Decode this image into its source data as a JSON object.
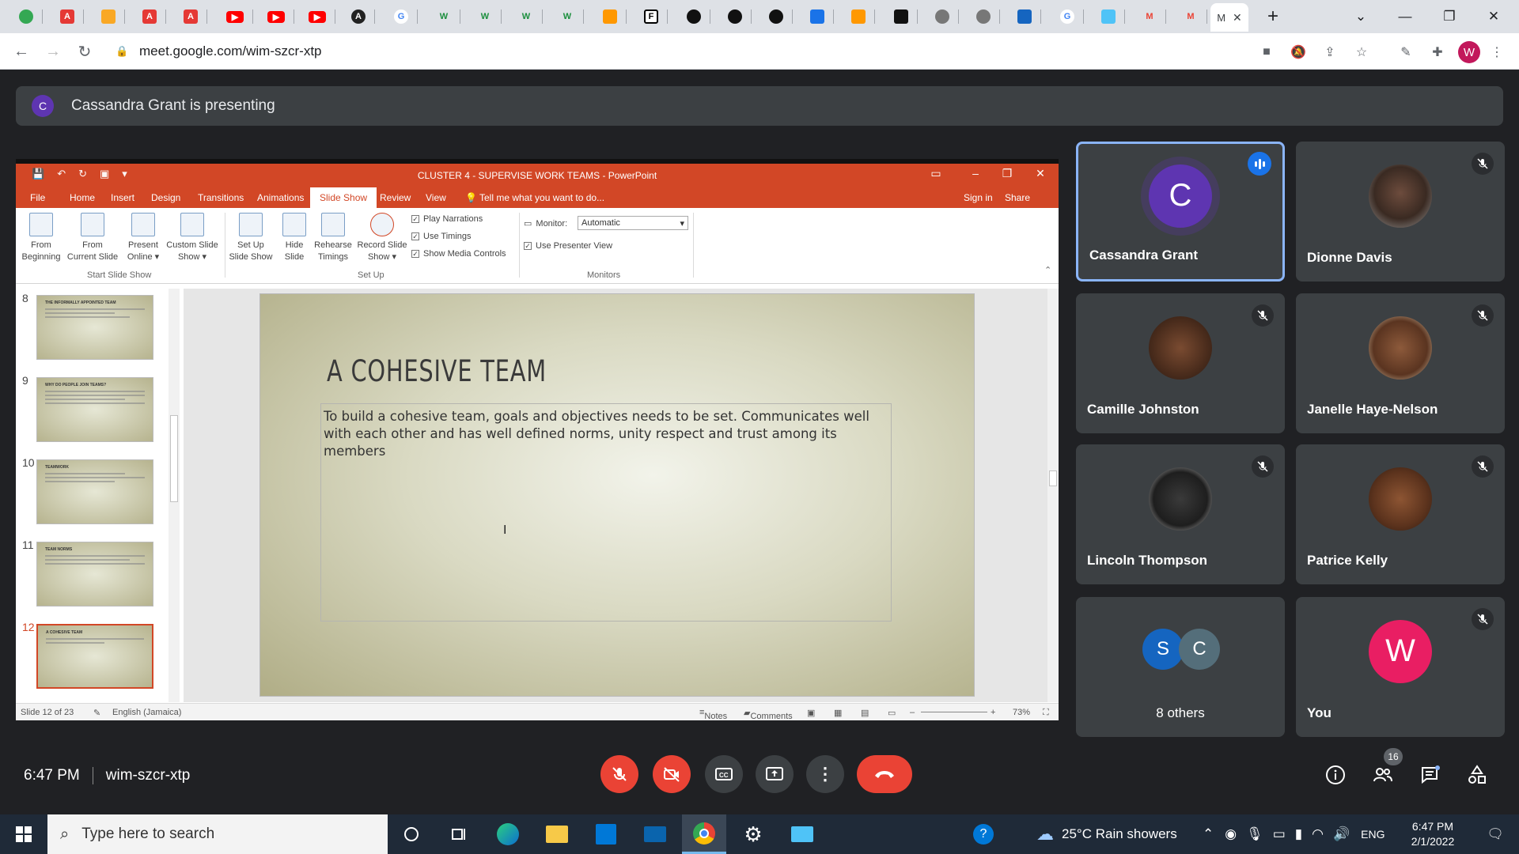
{
  "browser": {
    "active_tab_title": "M",
    "url": "meet.google.com/wim-szcr-xtp",
    "profile_initial": "W"
  },
  "meet": {
    "presenting_banner": "Cassandra Grant is presenting",
    "presenter_initial": "C",
    "time": "6:47 PM",
    "meeting_code": "wim-szcr-xtp",
    "participants_count": "16",
    "tiles": {
      "t1": {
        "name": "Cassandra Grant",
        "initial": "C"
      },
      "t2": {
        "name": "Dionne Davis"
      },
      "t3": {
        "name": "Camille Johnston"
      },
      "t4": {
        "name": "Janelle Haye-Nelson"
      },
      "t5": {
        "name": "Lincoln Thompson"
      },
      "t6": {
        "name": "Patrice Kelly"
      },
      "t7": {
        "name": "8 others",
        "initial_a": "S",
        "initial_b": "C"
      },
      "t8": {
        "name": "You",
        "initial": "W"
      }
    }
  },
  "ppt": {
    "window_title": "CLUSTER 4 - SUPERVISE WORK TEAMS - PowerPoint",
    "menu": {
      "file": "File",
      "home": "Home",
      "insert": "Insert",
      "design": "Design",
      "transitions": "Transitions",
      "animations": "Animations",
      "slideshow": "Slide Show",
      "review": "Review",
      "view": "View",
      "tell": "Tell me what you want to do...",
      "signin": "Sign in",
      "share": "Share"
    },
    "ribbon": {
      "from_beginning": "From\nBeginning",
      "from_current": "From\nCurrent Slide",
      "present_online": "Present\nOnline ▾",
      "custom_slide": "Custom Slide\nShow ▾",
      "setup_show": "Set Up\nSlide Show",
      "hide_slide": "Hide\nSlide",
      "rehearse": "Rehearse\nTimings",
      "record": "Record Slide\nShow ▾",
      "play_narrations": "Play Narrations",
      "use_timings": "Use Timings",
      "show_media": "Show Media Controls",
      "monitor_label": "Monitor:",
      "monitor_value": "Automatic",
      "use_presenter": "Use Presenter View",
      "group_start": "Start Slide Show",
      "group_setup": "Set Up",
      "group_monitors": "Monitors"
    },
    "thumbnails": [
      {
        "num": "8",
        "title": "THE INFORMALLY APPOINTED TEAM"
      },
      {
        "num": "9",
        "title": "WHY DO PEOPLE JOIN TEAMS?"
      },
      {
        "num": "10",
        "title": "TEAMWORK"
      },
      {
        "num": "11",
        "title": "TEAM NORMS"
      },
      {
        "num": "12",
        "title": "A COHESIVE TEAM"
      }
    ],
    "slide": {
      "title": "A COHESIVE TEAM",
      "body": "To build a cohesive team, goals and objectives needs to be set.  Communicates well with each other and has well defined norms, unity respect and trust among its members"
    },
    "status": {
      "slide_of": "Slide 12 of 23",
      "language": "English (Jamaica)",
      "notes": "Notes",
      "comments": "Comments",
      "zoom": "73%"
    }
  },
  "taskbar": {
    "search_placeholder": "Type here to search",
    "weather": "25°C  Rain showers",
    "lang": "ENG",
    "time": "6:47 PM",
    "date": "2/1/2022"
  }
}
